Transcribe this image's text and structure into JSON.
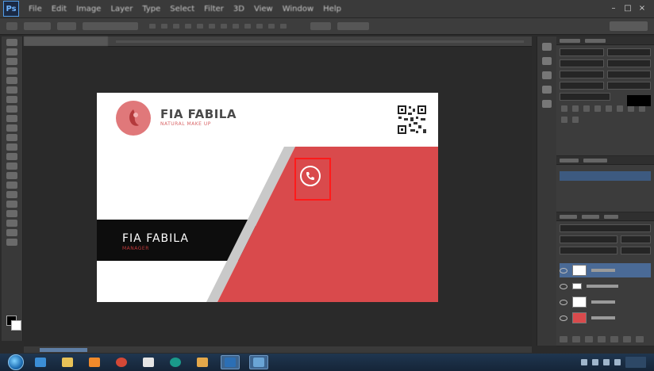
{
  "app": {
    "logo_text": "Ps",
    "menu": [
      "File",
      "Edit",
      "Image",
      "Layer",
      "Type",
      "Select",
      "Filter",
      "3D",
      "View",
      "Window",
      "Help"
    ],
    "window_controls": [
      "–",
      "□",
      "×"
    ]
  },
  "card": {
    "brand_name": "FIA FABILA",
    "brand_tagline": "NATURAL MAKE UP",
    "name": "FIA FABILA",
    "role": "MANAGER",
    "colors": {
      "red": "#d94a4c",
      "dark_band": "#0d0d0d",
      "logo_circle": "#e0787a",
      "selection": "#ff1a1a"
    }
  },
  "icons": {
    "phone": "phone-icon",
    "qr": "qr-code-icon",
    "eye": "visibility-eye-icon",
    "start": "windows-start-icon"
  },
  "taskbar": {
    "apps": [
      {
        "name": "ie-icon",
        "color": "#3b8ed6"
      },
      {
        "name": "explorer-icon",
        "color": "#e8c257"
      },
      {
        "name": "media-icon",
        "color": "#f08a2b"
      },
      {
        "name": "chrome-icon",
        "color": "#d34836"
      },
      {
        "name": "gmail-icon",
        "color": "#e5e5e5"
      },
      {
        "name": "edge-icon",
        "color": "#1a9a8a"
      },
      {
        "name": "folder-icon",
        "color": "#e4a84a"
      },
      {
        "name": "photoshop-icon",
        "color": "#2c6fb5"
      },
      {
        "name": "window-icon",
        "color": "#6aa5d6"
      }
    ]
  }
}
